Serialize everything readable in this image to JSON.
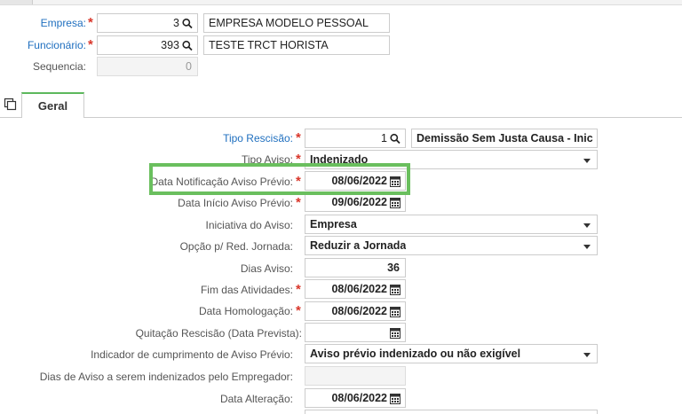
{
  "header": {
    "empresa": {
      "label": "Empresa:",
      "code": "3",
      "name": "EMPRESA MODELO PESSOAL"
    },
    "funcionario": {
      "label": "Funcionário:",
      "code": "393",
      "name": "TESTE TRCT HORISTA"
    },
    "sequencia": {
      "label": "Sequencia:",
      "value": "0"
    }
  },
  "tabs": [
    {
      "label": "Geral",
      "active": true
    }
  ],
  "form": {
    "tipo_rescisao": {
      "label": "Tipo Rescisão:",
      "code": "1",
      "description": "Demissão Sem Justa Causa - Inic"
    },
    "tipo_aviso": {
      "label": "Tipo Aviso:",
      "value": "Indenizado"
    },
    "data_notificacao": {
      "label": "Data Notificação Aviso Prévio:",
      "value": "08/06/2022"
    },
    "data_inicio_aviso": {
      "label": "Data Início Aviso Prévio:",
      "value": "09/06/2022"
    },
    "iniciativa_aviso": {
      "label": "Iniciativa do Aviso:",
      "value": "Empresa"
    },
    "opcao_red_jornada": {
      "label": "Opção p/ Red. Jornada:",
      "value": "Reduzir a Jornada"
    },
    "dias_aviso": {
      "label": "Dias Aviso:",
      "value": "36"
    },
    "fim_atividades": {
      "label": "Fim das Atividades:",
      "value": "08/06/2022"
    },
    "data_homologacao": {
      "label": "Data Homologação:",
      "value": "08/06/2022"
    },
    "quitacao_rescisao": {
      "label": "Quitação Rescisão (Data Prevista):",
      "value": ""
    },
    "indicador_cumprimento": {
      "label": "Indicador de cumprimento de Aviso Prévio:",
      "value": "Aviso prévio indenizado ou não exigível"
    },
    "dias_indenizados": {
      "label": "Dias de Aviso a serem indenizados pelo Empregador:",
      "value": ""
    },
    "data_alteracao": {
      "label": "Data Alteração:",
      "value": "08/06/2022"
    }
  },
  "colors": {
    "required": "#d9372b",
    "link_label": "#1f6fbf",
    "highlight": "#6abf5e",
    "tab_accent": "#5cb85c"
  },
  "icons": {
    "lookup": "search-icon",
    "date": "calendar-icon",
    "dropdown": "chevron-down-icon",
    "copy": "copy-icon"
  }
}
